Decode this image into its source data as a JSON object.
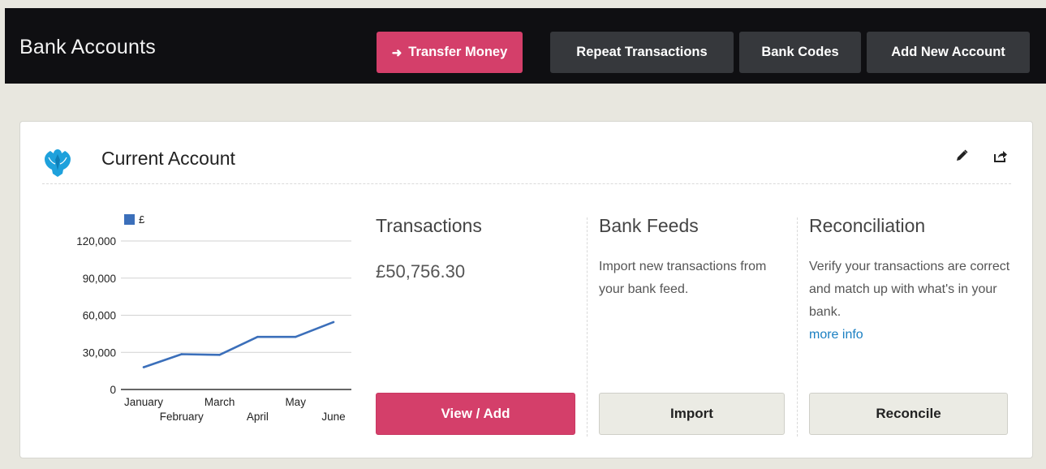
{
  "header": {
    "title": "Bank Accounts",
    "buttons": {
      "transfer": "Transfer Money",
      "repeat": "Repeat Transactions",
      "codes": "Bank Codes",
      "add_account": "Add New Account"
    }
  },
  "account": {
    "name": "Current Account",
    "icons": [
      "pencil-icon",
      "share-icon"
    ]
  },
  "chart_data": {
    "type": "line",
    "categories": [
      "January",
      "February",
      "March",
      "April",
      "May",
      "June"
    ],
    "series": [
      {
        "name": "£",
        "values": [
          18000,
          28500,
          28000,
          42500,
          42500,
          54500
        ],
        "color": "#3b6fba"
      }
    ],
    "legend": "top-left",
    "ylim": [
      0,
      120000
    ],
    "yticks": [
      "0",
      "30,000",
      "60,000",
      "90,000",
      "120,000"
    ],
    "grid": true
  },
  "transactions": {
    "title": "Transactions",
    "amount": "£50,756.30",
    "button": "View / Add"
  },
  "bank_feeds": {
    "title": "Bank Feeds",
    "text": "Import new transactions from your bank feed.",
    "button": "Import"
  },
  "reconciliation": {
    "title": "Reconciliation",
    "text": "Verify your transactions are correct and match up with what's in your bank.",
    "link": "more info",
    "button": "Reconcile"
  },
  "colors": {
    "accent": "#d43f6a",
    "header_bg": "#0f0f12",
    "link": "#1a7fc2",
    "chart_line": "#3b6fba"
  }
}
